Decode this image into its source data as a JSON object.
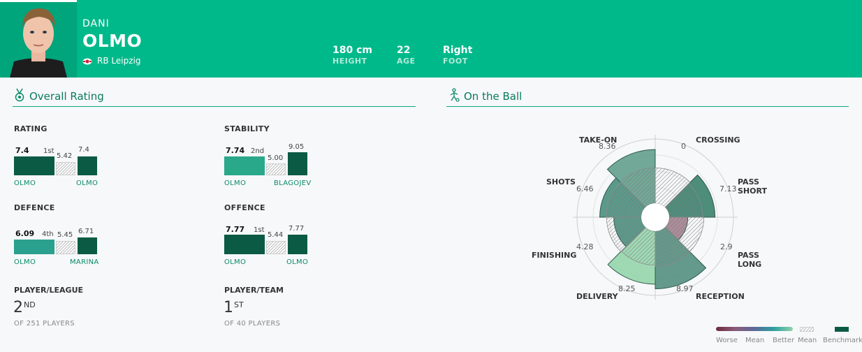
{
  "player": {
    "first_name": "DANI",
    "last_name": "OLMO",
    "club": "RB Leipzig",
    "stats": [
      {
        "value": "180 cm",
        "label": "HEIGHT"
      },
      {
        "value": "22",
        "label": "AGE"
      },
      {
        "value": "Right",
        "label": "FOOT"
      }
    ]
  },
  "overall": {
    "title": "Overall Rating",
    "blocks": [
      {
        "title": "RATING",
        "player_value": "7.4",
        "rank": "1st",
        "mean_value": "5.42",
        "bench_value": "7.4",
        "player_name": "OLMO",
        "bench_name": "OLMO"
      },
      {
        "title": "STABILITY",
        "player_value": "7.74",
        "rank": "2nd",
        "mean_value": "5.00",
        "bench_value": "9.05",
        "player_name": "OLMO",
        "bench_name": "BLAGOJEV"
      },
      {
        "title": "DEFENCE",
        "player_value": "6.09",
        "rank": "4th",
        "mean_value": "5.45",
        "bench_value": "6.71",
        "player_name": "OLMO",
        "bench_name": "MARINA"
      },
      {
        "title": "OFFENCE",
        "player_value": "7.77",
        "rank": "1st",
        "mean_value": "5.44",
        "bench_value": "7.77",
        "player_name": "OLMO",
        "bench_name": "OLMO"
      }
    ],
    "player_league": {
      "title": "PLAYER/LEAGUE",
      "value": "2",
      "suffix": "ND",
      "sub": "OF 251 PLAYERS"
    },
    "player_team": {
      "title": "PLAYER/TEAM",
      "value": "1",
      "suffix": "ST",
      "sub": "OF 40 PLAYERS"
    }
  },
  "on_the_ball": {
    "title": "On the Ball"
  },
  "chart_data": {
    "type": "radar",
    "categories": [
      "CROSSING",
      "PASS SHORT",
      "PASS LONG",
      "RECEPTION",
      "DELIVERY",
      "FINISHING",
      "SHOTS",
      "TAKE-ON"
    ],
    "values": [
      0,
      7.13,
      2.9,
      8.97,
      8.25,
      4.28,
      6.46,
      8.36
    ],
    "value_labels": [
      "0",
      "7.13",
      "2.9",
      "8.97",
      "8.25",
      "4.28",
      "6.46",
      "8.36"
    ],
    "rlim": [
      0,
      10
    ]
  },
  "legend": {
    "worse": "Worse",
    "mean": "Mean",
    "better": "Better",
    "mean_hatch": "Mean",
    "benchmark": "Benchmark"
  },
  "colors": {
    "header": "#00b98a",
    "dark_green": "#0b5a44",
    "teal": "#2aa88a",
    "mid_green": "#5a9a86",
    "light_green": "#8fd3a8",
    "mauve": "#a07a8a"
  }
}
